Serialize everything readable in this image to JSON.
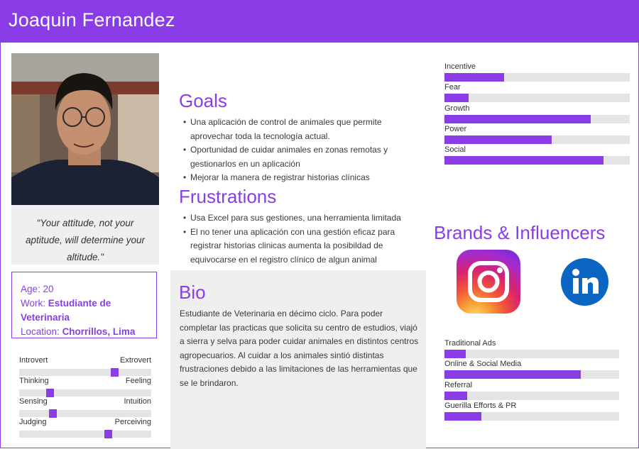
{
  "persona": {
    "name": "Joaquin Fernandez",
    "quote": "\"Your attitude, not your aptitude, will determine your altitude.\"",
    "age_label": "Age:",
    "age": "20",
    "work_label": "Work:",
    "work": "Estudiante de Veterinaria",
    "location_label": "Location:",
    "location": "Chorrillos, Lima"
  },
  "traits": [
    {
      "left": "Introvert",
      "right": "Extrovert",
      "value": 0.72
    },
    {
      "left": "Thinking",
      "right": "Feeling",
      "value": 0.23
    },
    {
      "left": "Sensing",
      "right": "Intuition",
      "value": 0.25
    },
    {
      "left": "Judging",
      "right": "Perceiving",
      "value": 0.67
    }
  ],
  "goals": {
    "title": "Goals",
    "items": [
      "Una aplicación de control de animales que permite aprovechar toda la tecnología actual.",
      "Oportunidad de cuidar animales en zonas remotas y gestionarlos en un aplicación",
      "Mejorar la manera de registrar historias clínicas"
    ]
  },
  "frustrations": {
    "title": "Frustrations",
    "items": [
      "Usa Excel para sus gestiones, una herramienta limitada",
      "El no tener una aplicación con una gestión eficaz para registrar historias clinicas aumenta la posibildad de equivocarse en el registro clínico de algun animal"
    ]
  },
  "bio": {
    "title": "Bio",
    "text": "Estudiante de Veterinaria en décimo ciclo. Para poder completar las practicas que solicita su centro de estudios, viajó a sierra y selva para poder cuidar animales en distintos centros agropecuarios. Al cuidar a los animales sintió distintas frustraciones debido a las limitaciones de las herramientas que se le brindaron."
  },
  "motivations": [
    {
      "label": "Incentive",
      "value": 0.32
    },
    {
      "label": "Fear",
      "value": 0.13
    },
    {
      "label": "Growth",
      "value": 0.79
    },
    {
      "label": "Power",
      "value": 0.58
    },
    {
      "label": "Social",
      "value": 0.86
    }
  ],
  "brands": {
    "title": "Brands & Influencers",
    "logos": [
      "instagram-logo",
      "linkedin-logo"
    ]
  },
  "channels": [
    {
      "label": "Traditional Ads",
      "value": 0.12
    },
    {
      "label": "Online & Social Media",
      "value": 0.78
    },
    {
      "label": "Referral",
      "value": 0.13
    },
    {
      "label": "Guerilla Efforts & PR",
      "value": 0.21
    }
  ],
  "colors": {
    "accent": "#8a3de6",
    "panel": "#efefef",
    "track": "#e4e4e4"
  }
}
